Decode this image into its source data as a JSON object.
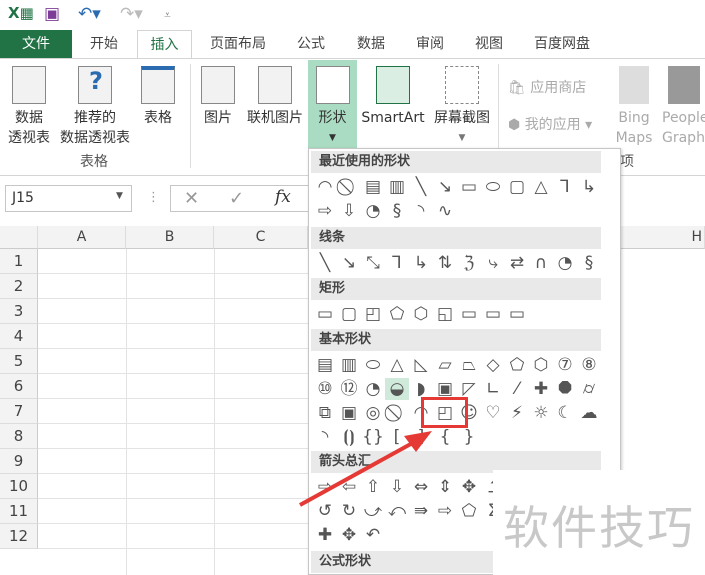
{
  "qat": {
    "excel_icon": "excel-logo",
    "save": "save-icon",
    "undo": "undo-icon",
    "redo": "redo-icon",
    "customize": "customize-qat-icon"
  },
  "tabs": [
    "文件",
    "开始",
    "插入",
    "页面布局",
    "公式",
    "数据",
    "审阅",
    "视图",
    "百度网盘"
  ],
  "active_tab": "插入",
  "ribbon": {
    "pivot": [
      "数据",
      "透视表"
    ],
    "recommended_pivot": [
      "推荐的",
      "数据透视表"
    ],
    "table": "表格",
    "group_table": "表格",
    "picture": "图片",
    "online_picture": "联机图片",
    "shapes": "形状",
    "smartart": "SmartArt",
    "screenshot": "屏幕截图",
    "app_store": "应用商店",
    "my_apps": "我的应用",
    "bing": [
      "Bing",
      "Maps"
    ],
    "people": [
      "People",
      "Graph"
    ],
    "group_addins_partial": "项"
  },
  "formula_bar": {
    "name_box": "J15",
    "cancel": "✕",
    "enter": "✓",
    "fx": "fx"
  },
  "columns": [
    "A",
    "B",
    "C",
    "H"
  ],
  "rows": [
    "1",
    "2",
    "3",
    "4",
    "5",
    "6",
    "7",
    "8",
    "9",
    "10",
    "11",
    "12"
  ],
  "shapes_menu": {
    "sections": [
      {
        "title": "最近使用的形状",
        "rows": [
          [
            "◠",
            "⃠",
            "▤",
            "▥",
            "╲",
            "↘",
            "▭",
            "⬭",
            "▢",
            "△",
            "⅂",
            "↳"
          ],
          [
            "⇨",
            "⇩",
            "◔",
            "§",
            "◝",
            "∿"
          ]
        ]
      },
      {
        "title": "线条",
        "rows": [
          [
            "╲",
            "↘",
            "⤡",
            "⅂",
            "↳",
            "⇅",
            "ℨ",
            "⤷",
            "⇄",
            "∩",
            "◔",
            "§"
          ]
        ]
      },
      {
        "title": "矩形",
        "rows": [
          [
            "▭",
            "▢",
            "◰",
            "⬠",
            "⬡",
            "◱",
            "▭",
            "▭",
            "▭"
          ]
        ]
      },
      {
        "title": "基本形状",
        "rows": [
          [
            "▤",
            "▥",
            "⬭",
            "△",
            "◺",
            "▱",
            "⏢",
            "◇",
            "⬠",
            "⬡",
            "⑦",
            "⑧"
          ],
          [
            "⑩",
            "⑫",
            "◔",
            "◒",
            "◗",
            "▣",
            "◸",
            "∟",
            "⁄",
            "✚",
            "⯃",
            "⌭"
          ],
          [
            "⧉",
            "▣",
            "◎",
            "⃠",
            "◠",
            "◰",
            "☺",
            "♡",
            "⚡",
            "☼",
            "☾",
            "☁"
          ],
          [
            "◝",
            "⦗⦘",
            "{}",
            "[",
            "]",
            "{",
            "}"
          ]
        ]
      },
      {
        "title": "箭头总汇",
        "rows": [
          [
            "⇨",
            "⇦",
            "⇧",
            "⇩",
            "⇔",
            "⇕",
            "✥",
            "⮥"
          ],
          [
            "↺",
            "↻",
            "⤻",
            "⤺",
            "⇛",
            "⇨",
            "⬠",
            "Σ"
          ],
          [
            "✚",
            "✥",
            "↶"
          ]
        ]
      },
      {
        "title": "公式形状",
        "rows": []
      }
    ]
  },
  "highlight_color": "#e53935",
  "watermark": "软件技巧"
}
